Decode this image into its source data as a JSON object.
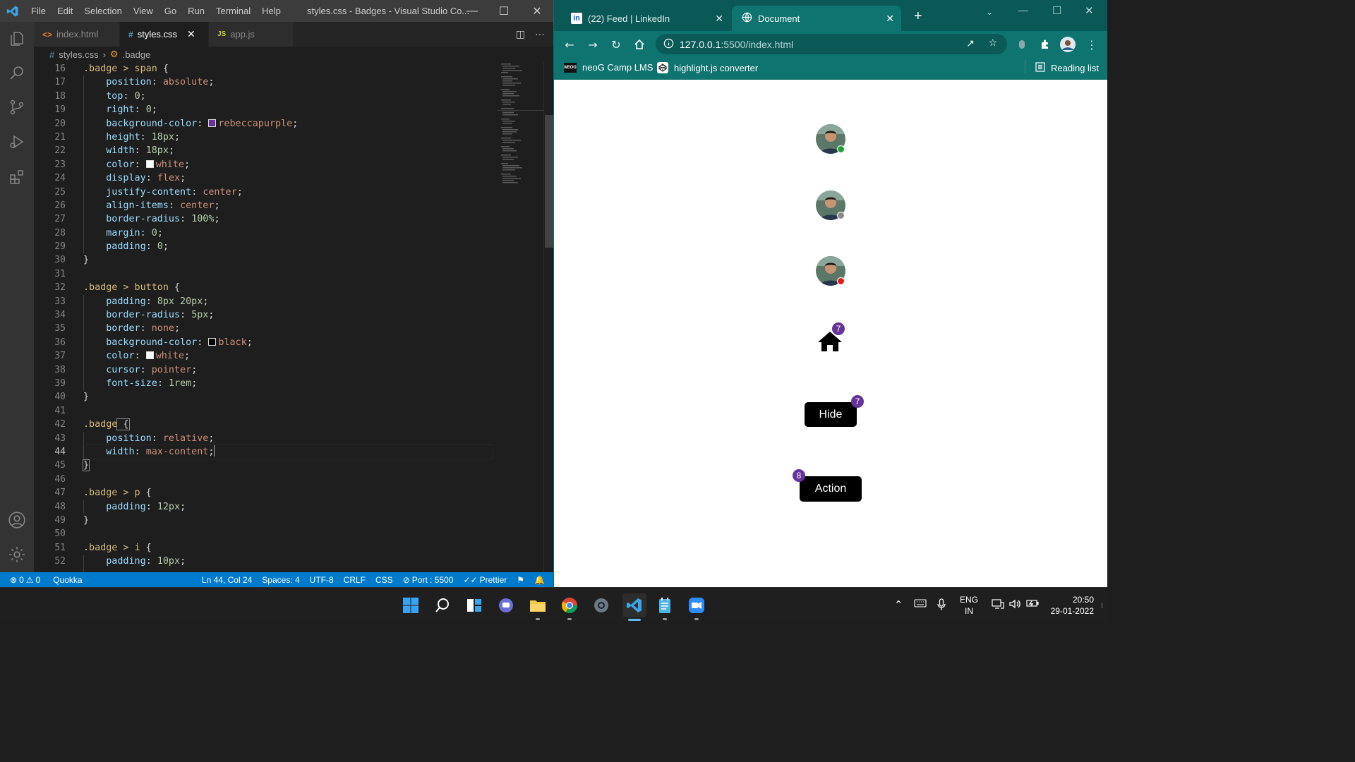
{
  "vscode": {
    "menu": [
      "File",
      "Edit",
      "Selection",
      "View",
      "Go",
      "Run",
      "Terminal",
      "Help"
    ],
    "window_title": "styles.css - Badges - Visual Studio Co...",
    "tabs": [
      {
        "icon": "<>",
        "label": "index.html"
      },
      {
        "icon": "#",
        "label": "styles.css"
      },
      {
        "icon": "JS",
        "label": "app.js"
      }
    ],
    "breadcrumb": {
      "file": "styles.css",
      "symbol": ".badge"
    },
    "line_numbers": [
      "16",
      "17",
      "18",
      "19",
      "20",
      "21",
      "22",
      "23",
      "24",
      "25",
      "26",
      "27",
      "28",
      "29",
      "30",
      "31",
      "32",
      "33",
      "34",
      "35",
      "36",
      "37",
      "38",
      "39",
      "40",
      "41",
      "42",
      "43",
      "44",
      "45",
      "46",
      "47",
      "48",
      "49",
      "50",
      "51",
      "52"
    ],
    "active_line": "44",
    "code": {
      "l16": {
        "sel": ".badge > span",
        "open": " {"
      },
      "l17": {
        "prop": "position",
        "val": "absolute"
      },
      "l18": {
        "prop": "top",
        "val": "0"
      },
      "l19": {
        "prop": "right",
        "val": "0"
      },
      "l20": {
        "prop": "background-color",
        "val": "rebeccapurple",
        "swatch": "#663399"
      },
      "l21": {
        "prop": "height",
        "val": "18px"
      },
      "l22": {
        "prop": "width",
        "val": "18px"
      },
      "l23": {
        "prop": "color",
        "val": "white",
        "swatch": "#ffffff"
      },
      "l24": {
        "prop": "display",
        "val": "flex"
      },
      "l25": {
        "prop": "justify-content",
        "val": "center"
      },
      "l26": {
        "prop": "align-items",
        "val": "center"
      },
      "l27": {
        "prop": "border-radius",
        "val": "100%"
      },
      "l28": {
        "prop": "margin",
        "val": "0"
      },
      "l29": {
        "prop": "padding",
        "val": "0"
      },
      "l30": {
        "close": "}"
      },
      "l32": {
        "sel": ".badge > button",
        "open": " {"
      },
      "l33": {
        "prop": "padding",
        "val": "8px 20px"
      },
      "l34": {
        "prop": "border-radius",
        "val": "5px"
      },
      "l35": {
        "prop": "border",
        "val": "none"
      },
      "l36": {
        "prop": "background-color",
        "val": "black",
        "swatch": "#000000"
      },
      "l37": {
        "prop": "color",
        "val": "white",
        "swatch": "#ffffff"
      },
      "l38": {
        "prop": "cursor",
        "val": "pointer"
      },
      "l39": {
        "prop": "font-size",
        "val": "1rem"
      },
      "l40": {
        "close": "}"
      },
      "l42": {
        "sel": ".badge",
        "open": " {"
      },
      "l43": {
        "prop": "position",
        "val": "relative"
      },
      "l44": {
        "prop": "width",
        "val": "max-content"
      },
      "l45": {
        "close": "}"
      },
      "l47": {
        "sel": ".badge > p",
        "open": " {"
      },
      "l48": {
        "prop": "padding",
        "val": "12px"
      },
      "l49": {
        "close": "}"
      },
      "l51": {
        "sel": ".badge > i",
        "open": " {"
      },
      "l52": {
        "prop": "padding",
        "val": "10px"
      }
    },
    "status": {
      "errors": "0",
      "warnings": "0",
      "quokka": "Quokka",
      "position": "Ln 44, Col 24",
      "spaces": "Spaces: 4",
      "encoding": "UTF-8",
      "eol": "CRLF",
      "language": "CSS",
      "port": "Port : 5500",
      "prettier": "Prettier"
    }
  },
  "browser": {
    "tabs": [
      {
        "label": "(22) Feed | LinkedIn"
      },
      {
        "label": "Document"
      }
    ],
    "url_host": "127.0.0.1",
    "url_path": ":5500/index.html",
    "bookmarks": [
      {
        "label": "neoG Camp LMS",
        "icon_text": "NEOG"
      },
      {
        "label": "highlight.js converter"
      }
    ],
    "reading_list": "Reading list",
    "page": {
      "avatars": [
        {
          "status": "online",
          "color": "#22a33a"
        },
        {
          "status": "away",
          "color": "#8a8a8a"
        },
        {
          "status": "busy",
          "color": "#e0201b"
        }
      ],
      "home_badge": "7",
      "hide_button": "Hide",
      "hide_badge": "7",
      "action_button": "Action",
      "action_badge": "8"
    }
  },
  "taskbar": {
    "language": "ENG",
    "region": "IN",
    "time": "20:50",
    "date": "29-01-2022"
  },
  "colors": {
    "vscode_status": "#007acc",
    "browser_frame": "#0f7370",
    "badge": "#663399"
  }
}
